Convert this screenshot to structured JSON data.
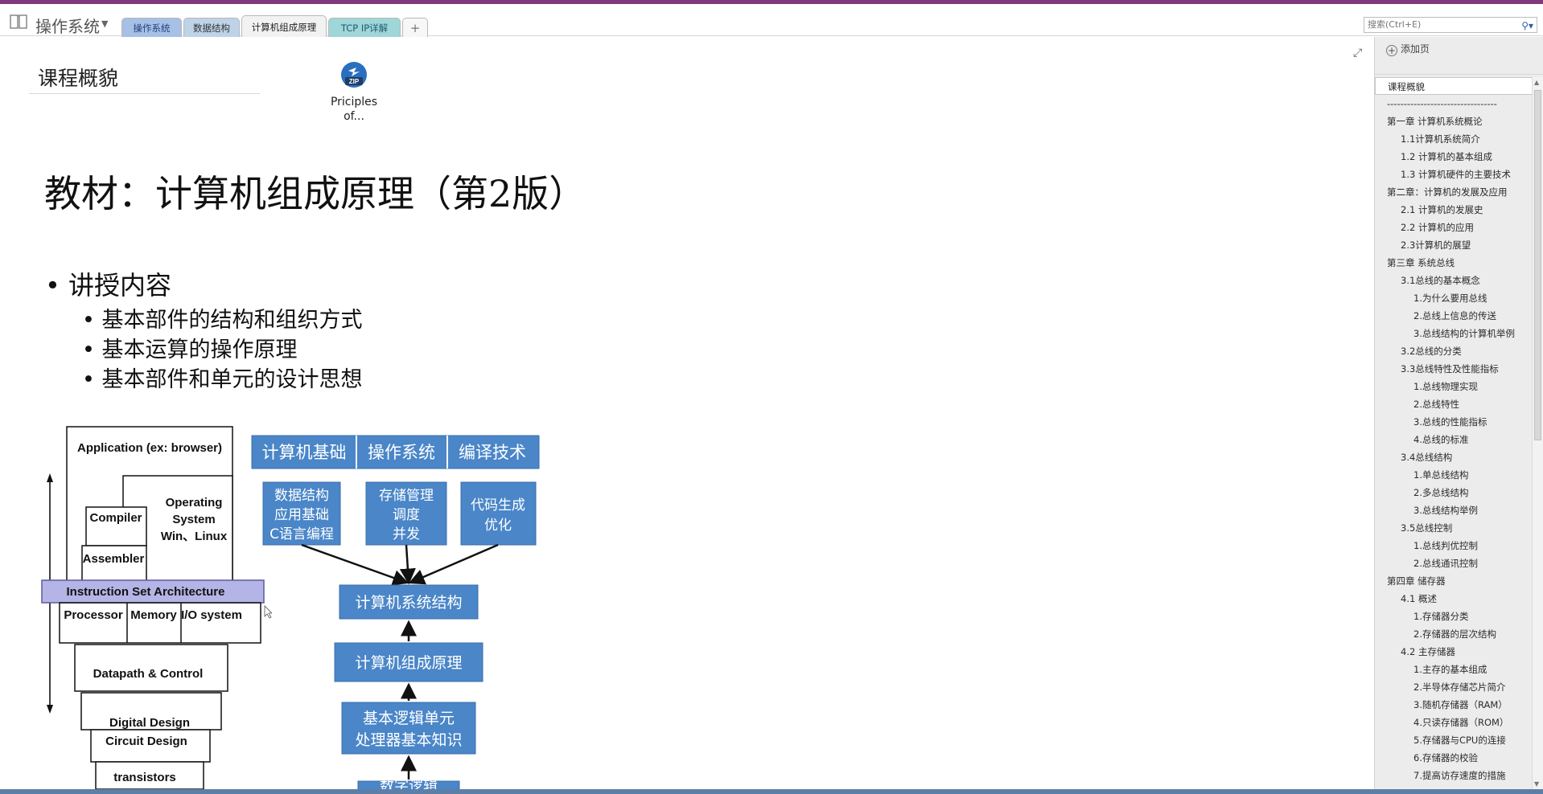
{
  "notebook": {
    "title": "操作系统",
    "caret": "▼"
  },
  "tabs": [
    {
      "label": "操作系统"
    },
    {
      "label": "数据结构"
    },
    {
      "label": "计算机组成原理"
    },
    {
      "label": "TCP IP详解"
    }
  ],
  "add_tab": "+",
  "search": {
    "placeholder": "搜索(Ctrl+E)"
  },
  "page": {
    "title": "课程概貌",
    "attachment": {
      "icon": "zip-file-icon",
      "badge": "ZIP",
      "label_line1": "Priciples",
      "label_line2": "of..."
    },
    "heading": "教材：计算机组成原理（第2版）",
    "bullet_main": "• 讲授内容",
    "bullets_sub": [
      "• 基本部件的结构和组织方式",
      "• 基本运算的操作原理",
      "• 基本部件和单元的设计思想"
    ],
    "layers_diagram": {
      "application": "Application (ex: browser)",
      "os_line1": "Operating",
      "os_line2": "System",
      "os_line3": "Win、Linux",
      "compiler": "Compiler",
      "assembler": "Assembler",
      "isa": "Instruction Set Architecture",
      "processor": "Processor",
      "memory": "Memory",
      "io": "I/O system",
      "datapath": "Datapath & Control",
      "digital": "Digital  Design",
      "circuit": "Circuit Design",
      "transistors": "transistors"
    },
    "course_diagram": {
      "top_bar": [
        "计算机基础",
        "操作系统",
        "编译技术"
      ],
      "box1": [
        "数据结构",
        "应用基础",
        "C语言编程"
      ],
      "box2": [
        "存储管理",
        "调度",
        "并发"
      ],
      "box3": [
        "代码生成",
        "优化"
      ],
      "arch": "计算机系统结构",
      "org": "计算机组成原理",
      "basic_line1": "基本逻辑单元",
      "basic_line2": "处理器基本知识",
      "digital_logic": "数字逻辑"
    }
  },
  "sidebar": {
    "add_page": "添加页",
    "pages": [
      {
        "label": "课程概貌",
        "level": 0,
        "selected": true
      },
      {
        "label": "---------------------------------",
        "level": 0
      },
      {
        "label": "第一章  计算机系统概论",
        "level": 0
      },
      {
        "label": "1.1计算机系统简介",
        "level": 1
      },
      {
        "label": "1.2 计算机的基本组成",
        "level": 1
      },
      {
        "label": "1.3 计算机硬件的主要技术",
        "level": 1
      },
      {
        "label": "第二章：计算机的发展及应用",
        "level": 0
      },
      {
        "label": "2.1 计算机的发展史",
        "level": 1
      },
      {
        "label": "2.2 计算机的应用",
        "level": 1
      },
      {
        "label": "2.3计算机的展望",
        "level": 1
      },
      {
        "label": "第三章  系统总线",
        "level": 0
      },
      {
        "label": "3.1总线的基本概念",
        "level": 1
      },
      {
        "label": "1.为什么要用总线",
        "level": 2
      },
      {
        "label": "2.总线上信息的传送",
        "level": 2
      },
      {
        "label": "3.总线结构的计算机举例",
        "level": 2
      },
      {
        "label": "3.2总线的分类",
        "level": 1
      },
      {
        "label": "3.3总线特性及性能指标",
        "level": 1
      },
      {
        "label": "1.总线物理实现",
        "level": 2
      },
      {
        "label": "2.总线特性",
        "level": 2
      },
      {
        "label": "3.总线的性能指标",
        "level": 2
      },
      {
        "label": "4.总线的标准",
        "level": 2
      },
      {
        "label": "3.4总线结构",
        "level": 1
      },
      {
        "label": "1.单总线结构",
        "level": 2
      },
      {
        "label": "2.多总线结构",
        "level": 2
      },
      {
        "label": "3.总线结构举例",
        "level": 2
      },
      {
        "label": "3.5总线控制",
        "level": 1
      },
      {
        "label": "1.总线判优控制",
        "level": 2
      },
      {
        "label": "2.总线通讯控制",
        "level": 2
      },
      {
        "label": "第四章  储存器",
        "level": 0
      },
      {
        "label": "4.1 概述",
        "level": 1
      },
      {
        "label": "1.存储器分类",
        "level": 2
      },
      {
        "label": "2.存储器的层次结构",
        "level": 2
      },
      {
        "label": "4.2 主存储器",
        "level": 1
      },
      {
        "label": "1.主存的基本组成",
        "level": 2
      },
      {
        "label": "2.半导体存储芯片简介",
        "level": 2
      },
      {
        "label": "3.随机存储器（RAM）",
        "level": 2
      },
      {
        "label": "4.只读存储器（ROM）",
        "level": 2
      },
      {
        "label": "5.存储器与CPU的连接",
        "level": 2
      },
      {
        "label": "6.存储器的校验",
        "level": 2
      },
      {
        "label": "7.提高访存速度的措施",
        "level": 2
      }
    ]
  },
  "colors": {
    "accent_bar": "#80397b",
    "diagram_blue": "#4a86c8",
    "isa_fill": "#b4b4e6"
  }
}
